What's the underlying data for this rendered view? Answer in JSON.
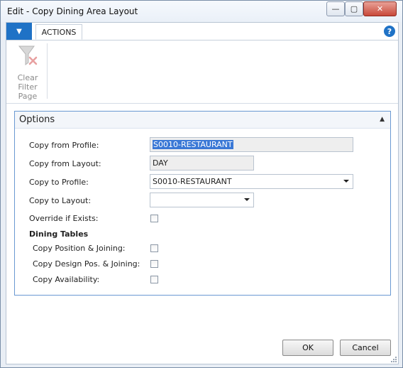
{
  "window": {
    "title": "Edit - Copy Dining Area Layout",
    "minimize_glyph": "—",
    "maximize_glyph": "▢",
    "close_glyph": "✕"
  },
  "ribbon": {
    "app_menu_glyph": "▼",
    "tab_actions": "ACTIONS",
    "help_glyph": "?",
    "clear_filter_label": "Clear Filter",
    "group_label": "Page"
  },
  "options": {
    "title": "Options",
    "collapse_glyph": "▲",
    "copy_from_profile_label": "Copy from Profile:",
    "copy_from_profile_value": "S0010-RESTAURANT",
    "copy_from_layout_label": "Copy from Layout:",
    "copy_from_layout_value": "DAY",
    "copy_to_profile_label": "Copy to Profile:",
    "copy_to_profile_value": "S0010-RESTAURANT",
    "copy_to_layout_label": "Copy to Layout:",
    "copy_to_layout_value": "",
    "override_label": "Override if Exists:",
    "override_checked": false,
    "dining_tables_heading": "Dining Tables",
    "copy_position_label": "Copy Position & Joining:",
    "copy_position_checked": false,
    "copy_design_label": "Copy Design Pos. & Joining:",
    "copy_design_checked": false,
    "copy_availability_label": "Copy Availability:",
    "copy_availability_checked": false
  },
  "buttons": {
    "ok": "OK",
    "cancel": "Cancel"
  },
  "icons": {
    "clear_filter": "clear-filter-icon",
    "help": "help-icon"
  },
  "colors": {
    "accent": "#1f72c6",
    "selection": "#3a78d6",
    "group_border": "#6a99d2"
  }
}
